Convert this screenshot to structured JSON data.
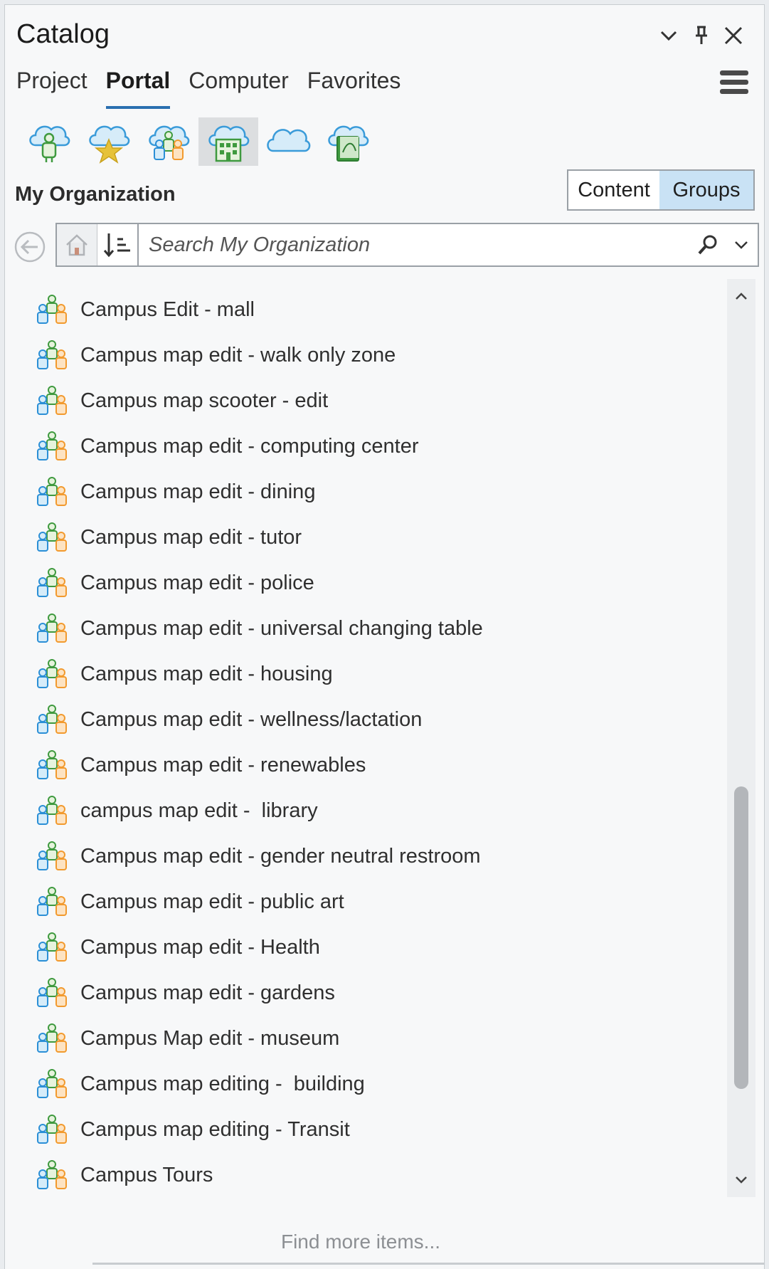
{
  "window": {
    "title": "Catalog"
  },
  "tabs": [
    {
      "label": "Project",
      "active": false
    },
    {
      "label": "Portal",
      "active": true
    },
    {
      "label": "Computer",
      "active": false
    },
    {
      "label": "Favorites",
      "active": false
    }
  ],
  "portal_icons": [
    {
      "name": "my-content-cloud-icon",
      "selected": false
    },
    {
      "name": "my-favorites-cloud-icon",
      "selected": false
    },
    {
      "name": "my-groups-cloud-icon",
      "selected": false
    },
    {
      "name": "my-organization-cloud-icon",
      "selected": true
    },
    {
      "name": "arcgis-online-cloud-icon",
      "selected": false
    },
    {
      "name": "living-atlas-cloud-icon",
      "selected": false
    }
  ],
  "section": {
    "title": "My Organization",
    "toggle": {
      "content_label": "Content",
      "groups_label": "Groups",
      "active": "Groups"
    }
  },
  "search": {
    "placeholder": "Search My Organization",
    "value": ""
  },
  "groups": [
    "Campus Edit - mall",
    "Campus map edit - walk only zone",
    "Campus map scooter - edit",
    "Campus map edit - computing center",
    "Campus map edit - dining",
    "Campus map edit - tutor",
    "Campus map edit - police",
    "Campus map edit - universal changing table",
    "Campus map edit - housing",
    "Campus map edit - wellness/lactation",
    "Campus map edit - renewables",
    "campus map edit -  library",
    "Campus map edit - gender neutral restroom",
    "Campus map edit - public art",
    "Campus map edit - Health",
    "Campus map edit - gardens",
    "Campus Map edit - museum",
    "Campus map editing -  building",
    "Campus map editing - Transit",
    "Campus Tours"
  ],
  "footer": {
    "find_more_label": "Find more items..."
  },
  "colors": {
    "accent": "#2a6fb0",
    "selected_toggle": "#c9e2f5",
    "group_icon_blue": "#2b8fd6",
    "group_icon_green": "#3f9a3f",
    "group_icon_orange": "#f29a2e"
  }
}
